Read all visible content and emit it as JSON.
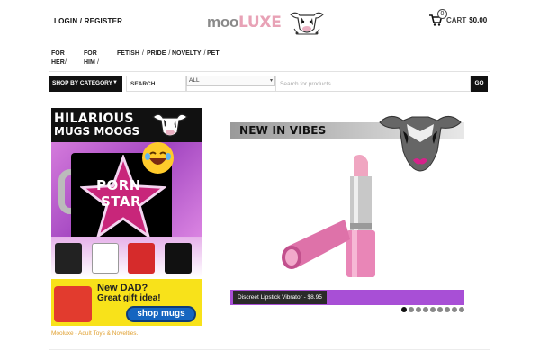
{
  "header": {
    "login_label": "LOGIN / REGISTER",
    "logo": {
      "part1": "moo",
      "part2": "LUXE"
    },
    "cart": {
      "count": "0",
      "label": "CART",
      "total": "$0.00"
    }
  },
  "categories": [
    {
      "label": "FOR HER"
    },
    {
      "label": "FOR HIM"
    },
    {
      "label": "FETISH"
    },
    {
      "label": "PRIDE"
    },
    {
      "label": "NOVELTY"
    },
    {
      "label": "PET"
    }
  ],
  "search": {
    "shop_by_category": "SHOP BY CATEGORY",
    "search_label": "SEARCH",
    "scope_selected": "ALL",
    "placeholder": "Search for products",
    "go_label": "GO"
  },
  "left_banner": {
    "title_line1": "HILARIOUS",
    "title_line2": "MUGS MOOGS",
    "mug_line1": "PORN",
    "mug_line2": "STAR",
    "promo_line1": "New DAD?",
    "promo_line2": "Great gift idea!",
    "cta_label": "shop mugs"
  },
  "slider": {
    "heading": "NEW IN VIBES",
    "caption": "Discreet Lipstick Vibrator - $8.95",
    "dot_count": 9,
    "active_dot": 0
  },
  "footer": {
    "tagline": "Mooluxe - Adult Toys & Novelties."
  },
  "colors": {
    "accent_purple": "#a84fd6",
    "logo_pink": "#e8a2b6",
    "footer_link": "#e0a030"
  }
}
